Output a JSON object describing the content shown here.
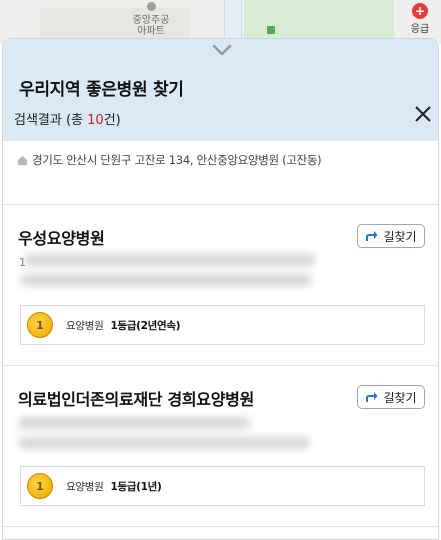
{
  "map": {
    "poi_label": "중앙주공\n아파트",
    "er_badge": "+",
    "er_label": "응급"
  },
  "panel": {
    "title": "우리지역 좋은병원 찾기",
    "result_prefix": "검색결과 (총 ",
    "result_count": "10",
    "result_suffix": "건)",
    "address": "경기도 안산시 단원구 고잔로 134, 안산중앙요양병원 (고잔동)"
  },
  "hospitals": [
    {
      "name": "우성요양병원",
      "directions_label": "길찾기",
      "grade_icon": "1",
      "grade_type": "요양병원",
      "grade_value": "1등급(2년연속)",
      "lead_char": "1"
    },
    {
      "name": "의료법인더존의료재단 경희요양병원",
      "directions_label": "길찾기",
      "grade_icon": "1",
      "grade_type": "요양병원",
      "grade_value": "1등급(1년)",
      "lead_char": ""
    }
  ],
  "colors": {
    "header_bg": "#dbe9f6",
    "count_red": "#d21a1a",
    "coin_gold": "#f3b50f",
    "directions_arrow": "#2b78c5"
  }
}
